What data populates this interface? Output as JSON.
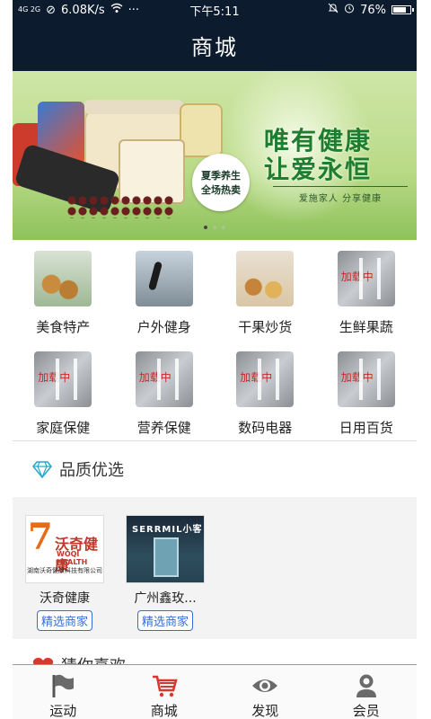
{
  "status_bar": {
    "network": "4G 2G",
    "speed": "6.08K/s",
    "more": "···",
    "time": "下午5:11",
    "battery": "76%",
    "battery_level": 0.76
  },
  "header": {
    "title": "商城"
  },
  "banner": {
    "promo_tag_line1": "夏季养生",
    "promo_tag_line2": "全场热卖",
    "slogan_line1": "唯有健康",
    "slogan_line2": "让爱永恒",
    "slogan_sub": "爱施家人 分享健康",
    "page_count": 3,
    "active_page": 1
  },
  "categories": [
    {
      "label": "美食特产",
      "image": "food-photo"
    },
    {
      "label": "户外健身",
      "image": "runner-photo"
    },
    {
      "label": "干果炒货",
      "image": "nuts-photo"
    },
    {
      "label": "生鲜果蔬",
      "image": "loading-placeholder"
    },
    {
      "label": "家庭保健",
      "image": "loading-placeholder"
    },
    {
      "label": "营养保健",
      "image": "loading-placeholder"
    },
    {
      "label": "数码电器",
      "image": "loading-placeholder"
    },
    {
      "label": "日用百货",
      "image": "loading-placeholder"
    }
  ],
  "placeholder_text": "加载中",
  "quality_section": {
    "title": "品质优选",
    "icon": "diamond-icon"
  },
  "merchants": [
    {
      "name": "沃奇健康",
      "tag": "精选商家",
      "logo_brand": "沃奇健康",
      "logo_en": "WOQI HEALTH",
      "logo_company": "湖南沃奇健康科技有限公司",
      "logo_number": "7"
    },
    {
      "name": "广州鑫玫...",
      "tag": "精选商家",
      "logo_title": "SERRMIL小客"
    }
  ],
  "guess_section": {
    "title": "猜你喜欢",
    "icon": "heart-icon"
  },
  "tabbar": [
    {
      "label": "运动",
      "icon": "flag-icon"
    },
    {
      "label": "商城",
      "icon": "cart-icon",
      "active": true
    },
    {
      "label": "发现",
      "icon": "eye-icon"
    },
    {
      "label": "会员",
      "icon": "user-icon"
    }
  ],
  "colors": {
    "header_bg": "#0d1b2e",
    "accent_red": "#d63a2f",
    "tag_blue": "#3b6bd6"
  }
}
